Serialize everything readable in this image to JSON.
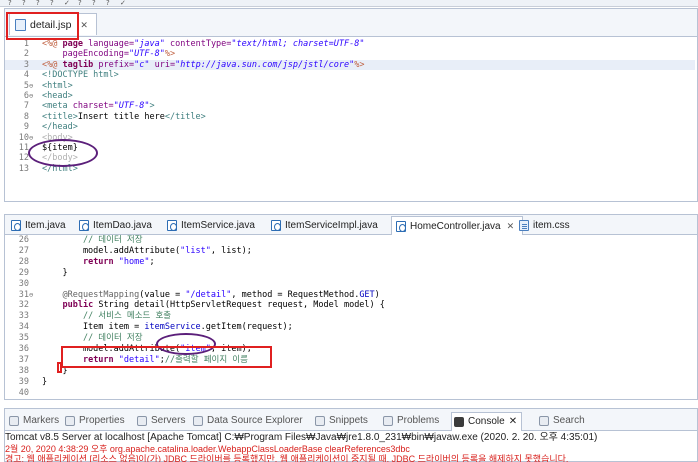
{
  "toolbar": {
    "glyphs": [
      "?",
      "?",
      "?",
      "?",
      "✓",
      "?",
      "?",
      "?",
      "✓"
    ]
  },
  "top_editor": {
    "tab": {
      "label": "detail.jsp",
      "close": "✕"
    },
    "lines": [
      {
        "num": "1",
        "fold": "",
        "segs": [
          [
            "dir",
            "<%@ "
          ],
          [
            "kw",
            "page"
          ],
          [
            "",
            " "
          ],
          [
            "attr",
            "language="
          ],
          [
            "str",
            "\"java\""
          ],
          [
            "",
            " "
          ],
          [
            "attr",
            "contentType="
          ],
          [
            "str",
            "\"text/html; charset=UTF-8\""
          ]
        ]
      },
      {
        "num": "2",
        "fold": "",
        "segs": [
          [
            "",
            "    "
          ],
          [
            "attr",
            "pageEncoding="
          ],
          [
            "str",
            "\"UTF-8\""
          ],
          [
            "dir",
            "%>"
          ]
        ]
      },
      {
        "num": "3",
        "fold": "",
        "hl": true,
        "segs": [
          [
            "dir",
            "<%@ "
          ],
          [
            "kw",
            "taglib"
          ],
          [
            "",
            " "
          ],
          [
            "attr",
            "prefix="
          ],
          [
            "str",
            "\"c\""
          ],
          [
            "",
            " "
          ],
          [
            "attr",
            "uri="
          ],
          [
            "str",
            "\"http://java.sun.com/jsp/jstl/core\""
          ],
          [
            "dir",
            "%>"
          ]
        ]
      },
      {
        "num": "4",
        "fold": "",
        "segs": [
          [
            "tag",
            "<!DOCTYPE html>"
          ]
        ]
      },
      {
        "num": "5",
        "fold": "⊖",
        "segs": [
          [
            "tag",
            "<html>"
          ]
        ]
      },
      {
        "num": "6",
        "fold": "⊖",
        "segs": [
          [
            "tag",
            "<head>"
          ]
        ]
      },
      {
        "num": "7",
        "fold": "",
        "segs": [
          [
            "tag",
            "<meta "
          ],
          [
            "attr",
            "charset="
          ],
          [
            "str",
            "\"UTF-8\""
          ],
          [
            "tag",
            ">"
          ]
        ]
      },
      {
        "num": "8",
        "fold": "",
        "segs": [
          [
            "tag",
            "<title>"
          ],
          [
            "",
            "Insert title here"
          ],
          [
            "tag",
            "</title>"
          ]
        ]
      },
      {
        "num": "9",
        "fold": "",
        "segs": [
          [
            "tag",
            "</head>"
          ]
        ]
      },
      {
        "num": "10",
        "fold": "⊖",
        "segs": [
          [
            "dim",
            "<body>"
          ]
        ]
      },
      {
        "num": "11",
        "fold": "",
        "segs": [
          [
            "",
            "${item}"
          ]
        ]
      },
      {
        "num": "12",
        "fold": "",
        "segs": [
          [
            "dim",
            "</body>"
          ]
        ]
      },
      {
        "num": "13",
        "fold": "",
        "segs": [
          [
            "tag",
            "</html>"
          ]
        ]
      }
    ]
  },
  "bottom_editor": {
    "tabs": [
      {
        "label": "Item.java",
        "icon": "java"
      },
      {
        "label": "ItemDao.java",
        "icon": "java"
      },
      {
        "label": "ItemService.java",
        "icon": "java"
      },
      {
        "label": "ItemServiceImpl.java",
        "icon": "java"
      },
      {
        "label": "HomeController.java",
        "icon": "java",
        "active": true,
        "close": "✕"
      },
      {
        "label": "item.css",
        "icon": "css"
      }
    ],
    "lines": [
      {
        "num": "26",
        "fold": "",
        "segs": [
          [
            "",
            "        "
          ],
          [
            "cmt",
            "// 데이터 저장"
          ]
        ]
      },
      {
        "num": "27",
        "fold": "",
        "segs": [
          [
            "",
            "        model.addAttribute("
          ],
          [
            "jstr",
            "\"list\""
          ],
          [
            "",
            ", list);"
          ]
        ]
      },
      {
        "num": "28",
        "fold": "",
        "segs": [
          [
            "",
            "        "
          ],
          [
            "kw",
            "return"
          ],
          [
            "",
            " "
          ],
          [
            "jstr",
            "\"home\""
          ],
          [
            "",
            ";"
          ]
        ]
      },
      {
        "num": "29",
        "fold": "",
        "segs": [
          [
            "",
            "    }"
          ]
        ]
      },
      {
        "num": "30",
        "fold": "",
        "segs": []
      },
      {
        "num": "31",
        "fold": "⊖",
        "segs": [
          [
            "",
            "    "
          ],
          [
            "ann",
            "@RequestMapping"
          ],
          [
            "",
            "(value = "
          ],
          [
            "jstr",
            "\"/detail\""
          ],
          [
            "",
            ", method = RequestMethod."
          ],
          [
            "fld",
            "GET"
          ],
          [
            "",
            ")"
          ]
        ]
      },
      {
        "num": "32",
        "fold": "",
        "segs": [
          [
            "",
            "    "
          ],
          [
            "kw",
            "public"
          ],
          [
            "",
            " String detail(HttpServletRequest request, Model model) {"
          ]
        ]
      },
      {
        "num": "33",
        "fold": "",
        "segs": [
          [
            "",
            "        "
          ],
          [
            "cmt",
            "// 서비스 메소드 호출"
          ]
        ]
      },
      {
        "num": "34",
        "fold": "",
        "segs": [
          [
            "",
            "        Item item = "
          ],
          [
            "fld",
            "itemService"
          ],
          [
            "",
            ".getItem(request);"
          ]
        ]
      },
      {
        "num": "35",
        "fold": "",
        "segs": [
          [
            "",
            "        "
          ],
          [
            "cmt",
            "// 데이터 저장"
          ]
        ]
      },
      {
        "num": "36",
        "fold": "",
        "segs": [
          [
            "",
            "        model.addAttribute("
          ],
          [
            "jstr",
            "\"item\""
          ],
          [
            "",
            ", item);"
          ]
        ]
      },
      {
        "num": "37",
        "fold": "",
        "segs": [
          [
            "",
            "        "
          ],
          [
            "kw",
            "return"
          ],
          [
            "",
            " "
          ],
          [
            "jstr",
            "\"detail\""
          ],
          [
            "",
            ";"
          ],
          [
            "cmt",
            "//출력할 페이지 이름"
          ]
        ]
      },
      {
        "num": "38",
        "fold": "",
        "segs": [
          [
            "",
            "    }"
          ]
        ]
      },
      {
        "num": "39",
        "fold": "",
        "segs": [
          [
            "",
            "}"
          ]
        ]
      },
      {
        "num": "40",
        "fold": "",
        "segs": []
      }
    ]
  },
  "console_panel": {
    "tabs": [
      {
        "label": "Markers"
      },
      {
        "label": "Properties"
      },
      {
        "label": "Servers",
        "prefix": "⪢"
      },
      {
        "label": "Data Source Explorer"
      },
      {
        "label": "Snippets"
      },
      {
        "label": "Problems"
      },
      {
        "label": "Console",
        "active": true,
        "close": "✕"
      },
      {
        "label": "Search"
      }
    ],
    "title": "Tomcat v8.5 Server at localhost [Apache Tomcat] C:₩Program Files₩Java₩jre1.8.0_231₩bin₩javaw.exe (2020. 2. 20. 오후 4:35:01)",
    "lines": [
      "2월 20, 2020 4:38:29 오후 org.apache.catalina.loader.WebappClassLoaderBase clearReferences3dbc",
      "경고: 웹 애플리케이션 [리소스 없음]이(가) JDBC 드라이버를 등록했지만, 웹 애플리케이션이 중지될 때, JDBC 드라이버의 등록을 해제하지 못했습니다."
    ]
  },
  "annotation_colors": {
    "red_box": "#e02020",
    "purple_ellipse": "#5b1f7a"
  }
}
